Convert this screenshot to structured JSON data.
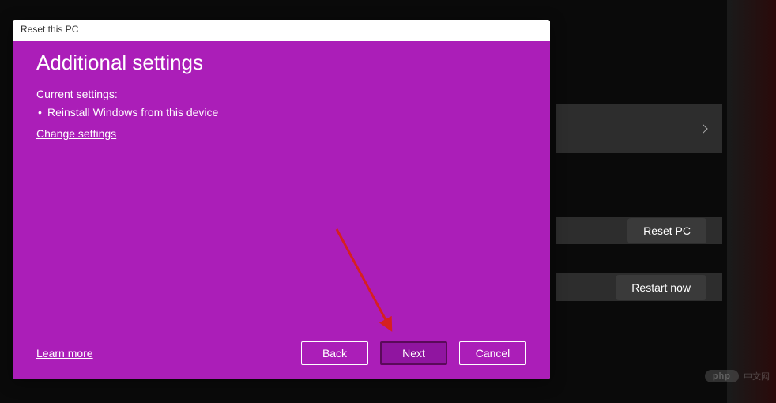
{
  "dialog": {
    "title": "Reset this PC",
    "heading": "Additional settings",
    "current_label": "Current settings:",
    "bullets": [
      "Reinstall Windows from this device"
    ],
    "change_link": "Change settings",
    "learn_more": "Learn more",
    "buttons": {
      "back": "Back",
      "next": "Next",
      "cancel": "Cancel"
    }
  },
  "background": {
    "reset_pc": "Reset PC",
    "restart_now": "Restart now"
  },
  "watermark": {
    "badge": "php",
    "text": "中文网"
  }
}
